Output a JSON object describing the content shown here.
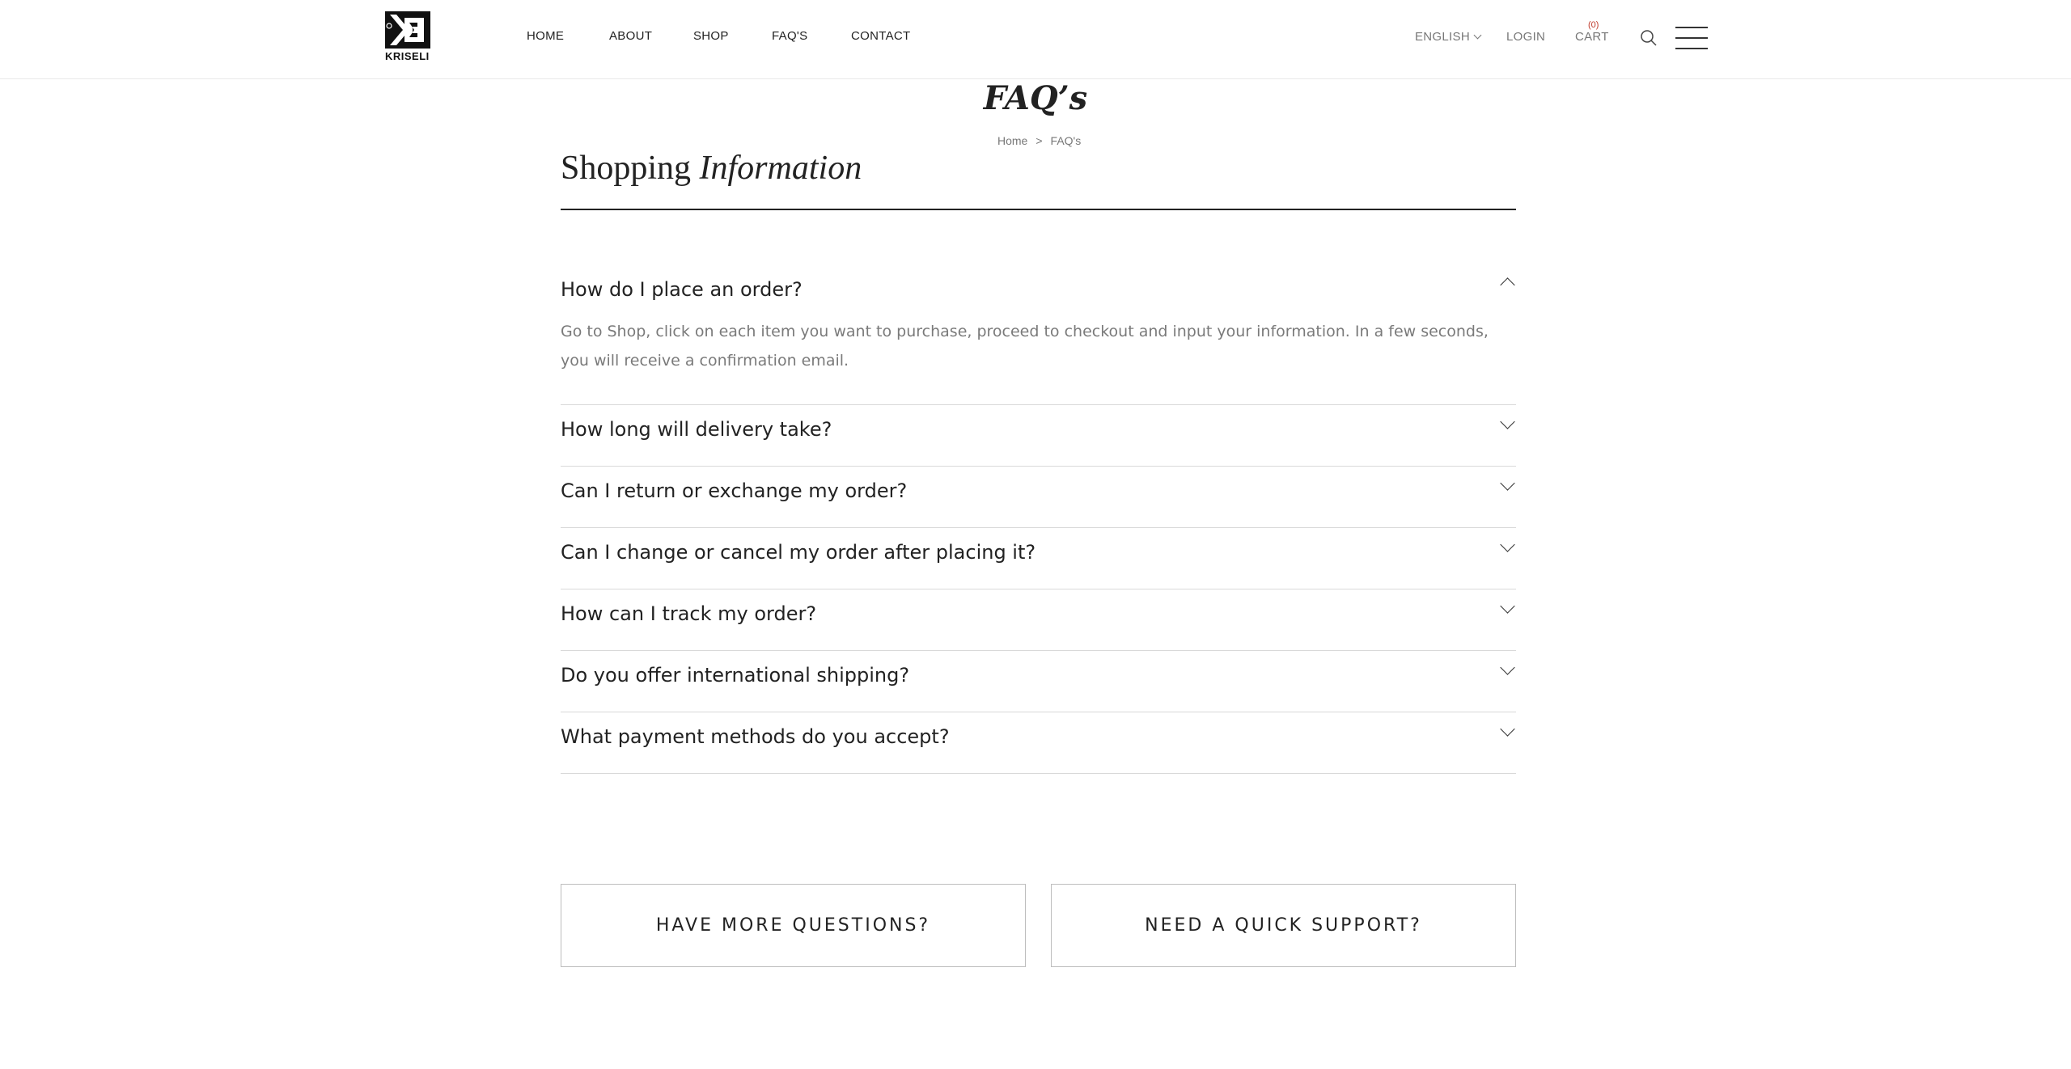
{
  "brand": {
    "name": "KRISELI"
  },
  "nav": {
    "items": [
      {
        "label": "HOME"
      },
      {
        "label": "ABOUT"
      },
      {
        "label": "SHOP"
      },
      {
        "label": "FAQ'S"
      },
      {
        "label": "CONTACT"
      }
    ]
  },
  "header": {
    "language": "ENGLISH",
    "login": "LOGIN",
    "cart_label": "CART",
    "cart_count": "(0)"
  },
  "page": {
    "title": "FAQ’s",
    "breadcrumb": {
      "home": "Home",
      "separator": ">",
      "current": "FAQ's"
    }
  },
  "section": {
    "title_plain": "Shopping",
    "title_italic": "Information"
  },
  "faq": [
    {
      "question": "How do I place an order?",
      "answer": "Go to Shop, click on each item you want to purchase, proceed to checkout and input your information. In a few seconds, you will receive a confirmation email.",
      "expanded": true
    },
    {
      "question": "How long will delivery take?",
      "expanded": false
    },
    {
      "question": "Can I return or exchange my order?",
      "expanded": false
    },
    {
      "question": "Can I change or cancel my order after placing it?",
      "expanded": false
    },
    {
      "question": "How can I track my order?",
      "expanded": false
    },
    {
      "question": "Do you offer international shipping?",
      "expanded": false
    },
    {
      "question": "What payment methods do you accept?",
      "expanded": false
    }
  ],
  "cta": {
    "left": "HAVE MORE QUESTIONS?",
    "right": "NEED A QUICK SUPPORT?"
  },
  "colors": {
    "text": "#222222",
    "muted": "#7a7a7a",
    "cart_count": "#c0392b",
    "divider": "#d9d9d9"
  },
  "icons": [
    "kriseli-logo-icon",
    "chevron-down-icon",
    "search-icon",
    "hamburger-menu-icon",
    "chevron-up-icon"
  ]
}
